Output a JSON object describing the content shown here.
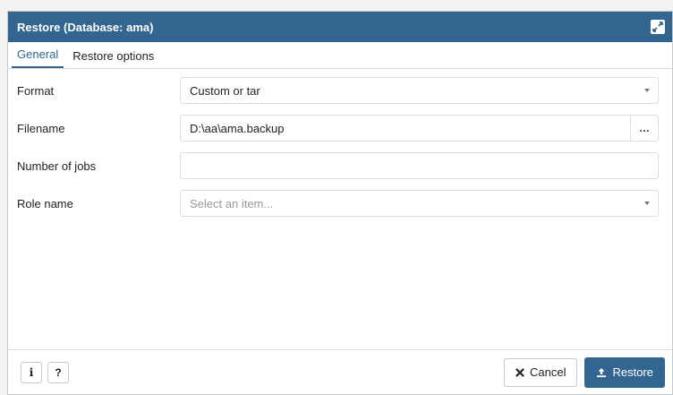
{
  "dialog": {
    "title": "Restore (Database: ama)",
    "expand_icon": "expand-icon"
  },
  "tabs": [
    {
      "label": "General",
      "active": true
    },
    {
      "label": "Restore options",
      "active": false
    }
  ],
  "form": {
    "format": {
      "label": "Format",
      "value": "Custom or tar"
    },
    "filename": {
      "label": "Filename",
      "value": "D:\\aa\\ama.backup",
      "browse_label": "…"
    },
    "jobs": {
      "label": "Number of jobs",
      "value": ""
    },
    "role": {
      "label": "Role name",
      "placeholder": "Select an item..."
    }
  },
  "footer": {
    "info_label": "i",
    "help_label": "?",
    "cancel_label": "Cancel",
    "restore_label": "Restore"
  },
  "colors": {
    "accent": "#326690",
    "border": "#dedede"
  }
}
